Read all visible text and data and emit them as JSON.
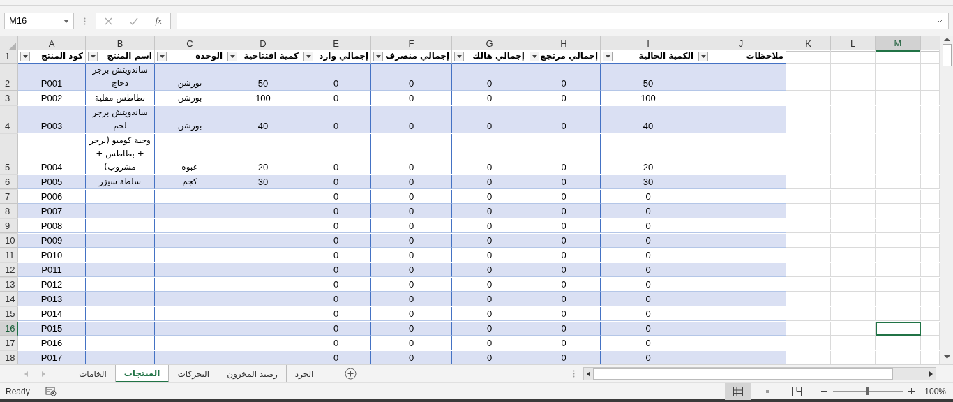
{
  "name_box": "M16",
  "function_button": "fx",
  "columns": [
    {
      "letter": "M",
      "selected": true
    },
    {
      "letter": "L",
      "selected": false
    },
    {
      "letter": "K",
      "selected": false
    },
    {
      "letter": "J",
      "selected": false
    },
    {
      "letter": "I",
      "selected": false
    },
    {
      "letter": "H",
      "selected": false
    },
    {
      "letter": "G",
      "selected": false
    },
    {
      "letter": "F",
      "selected": false
    },
    {
      "letter": "E",
      "selected": false
    },
    {
      "letter": "D",
      "selected": false
    },
    {
      "letter": "C",
      "selected": false
    },
    {
      "letter": "B",
      "selected": false
    },
    {
      "letter": "A",
      "selected": false
    }
  ],
  "header_row": {
    "row": "1",
    "selected": false,
    "headers": [
      "ملاحظات",
      "الكمية الحالية",
      "إجمالي مرتجع",
      "إجمالي هالك",
      "إجمالي منصرف",
      "إجمالي وارد",
      "كمية افتتاحية",
      "الوحدة",
      "اسم المنتج",
      "كود المنتج"
    ]
  },
  "rows": [
    {
      "row": "2",
      "selected": false,
      "code": "P001",
      "name": "ساندويتش برجر دجاج",
      "unit": "بورشن",
      "opening": "50",
      "in": "0",
      "out": "0",
      "lost": "0",
      "returned": "0",
      "current": "50"
    },
    {
      "row": "3",
      "selected": false,
      "code": "P002",
      "name": "بطاطس مقلية",
      "unit": "بورشن",
      "opening": "100",
      "in": "0",
      "out": "0",
      "lost": "0",
      "returned": "0",
      "current": "100"
    },
    {
      "row": "4",
      "selected": false,
      "code": "P003",
      "name": "ساندويتش برجر لحم",
      "unit": "بورشن",
      "opening": "40",
      "in": "0",
      "out": "0",
      "lost": "0",
      "returned": "0",
      "current": "40"
    },
    {
      "row": "5",
      "selected": false,
      "code": "P004",
      "name": "وجبة كومبو (برجر + بطاطس + مشروب)",
      "unit": "عبوة",
      "opening": "20",
      "in": "0",
      "out": "0",
      "lost": "0",
      "returned": "0",
      "current": "20"
    },
    {
      "row": "6",
      "selected": false,
      "code": "P005",
      "name": "سلطة سيزر",
      "unit": "كجم",
      "opening": "30",
      "in": "0",
      "out": "0",
      "lost": "0",
      "returned": "0",
      "current": "30"
    },
    {
      "row": "7",
      "selected": false,
      "code": "P006",
      "in": "0",
      "out": "0",
      "lost": "0",
      "returned": "0",
      "current": "0"
    },
    {
      "row": "8",
      "selected": false,
      "code": "P007",
      "in": "0",
      "out": "0",
      "lost": "0",
      "returned": "0",
      "current": "0"
    },
    {
      "row": "9",
      "selected": false,
      "code": "P008",
      "in": "0",
      "out": "0",
      "lost": "0",
      "returned": "0",
      "current": "0"
    },
    {
      "row": "10",
      "selected": false,
      "code": "P009",
      "in": "0",
      "out": "0",
      "lost": "0",
      "returned": "0",
      "current": "0"
    },
    {
      "row": "11",
      "selected": false,
      "code": "P010",
      "in": "0",
      "out": "0",
      "lost": "0",
      "returned": "0",
      "current": "0"
    },
    {
      "row": "12",
      "selected": false,
      "code": "P011",
      "in": "0",
      "out": "0",
      "lost": "0",
      "returned": "0",
      "current": "0"
    },
    {
      "row": "13",
      "selected": false,
      "code": "P012",
      "in": "0",
      "out": "0",
      "lost": "0",
      "returned": "0",
      "current": "0"
    },
    {
      "row": "14",
      "selected": false,
      "code": "P013",
      "in": "0",
      "out": "0",
      "lost": "0",
      "returned": "0",
      "current": "0"
    },
    {
      "row": "15",
      "selected": false,
      "code": "P014",
      "in": "0",
      "out": "0",
      "lost": "0",
      "returned": "0",
      "current": "0"
    },
    {
      "row": "16",
      "selected": true,
      "code": "P015",
      "in": "0",
      "out": "0",
      "lost": "0",
      "returned": "0",
      "current": "0"
    },
    {
      "row": "17",
      "selected": false,
      "code": "P016",
      "in": "0",
      "out": "0",
      "lost": "0",
      "returned": "0",
      "current": "0"
    },
    {
      "row": "18",
      "selected": false,
      "code": "P017",
      "in": "0",
      "out": "0",
      "lost": "0",
      "returned": "0",
      "current": "0"
    }
  ],
  "sheet_tabs": [
    {
      "label": "الجرد",
      "selected": false
    },
    {
      "label": "رصيد المخزون",
      "selected": false
    },
    {
      "label": "التحركات",
      "selected": false
    },
    {
      "label": "المنتجات",
      "selected": true
    },
    {
      "label": "الخامات",
      "selected": false
    }
  ],
  "status_bar": {
    "status": "Ready",
    "zoom": "100%",
    "level": 0.5
  }
}
